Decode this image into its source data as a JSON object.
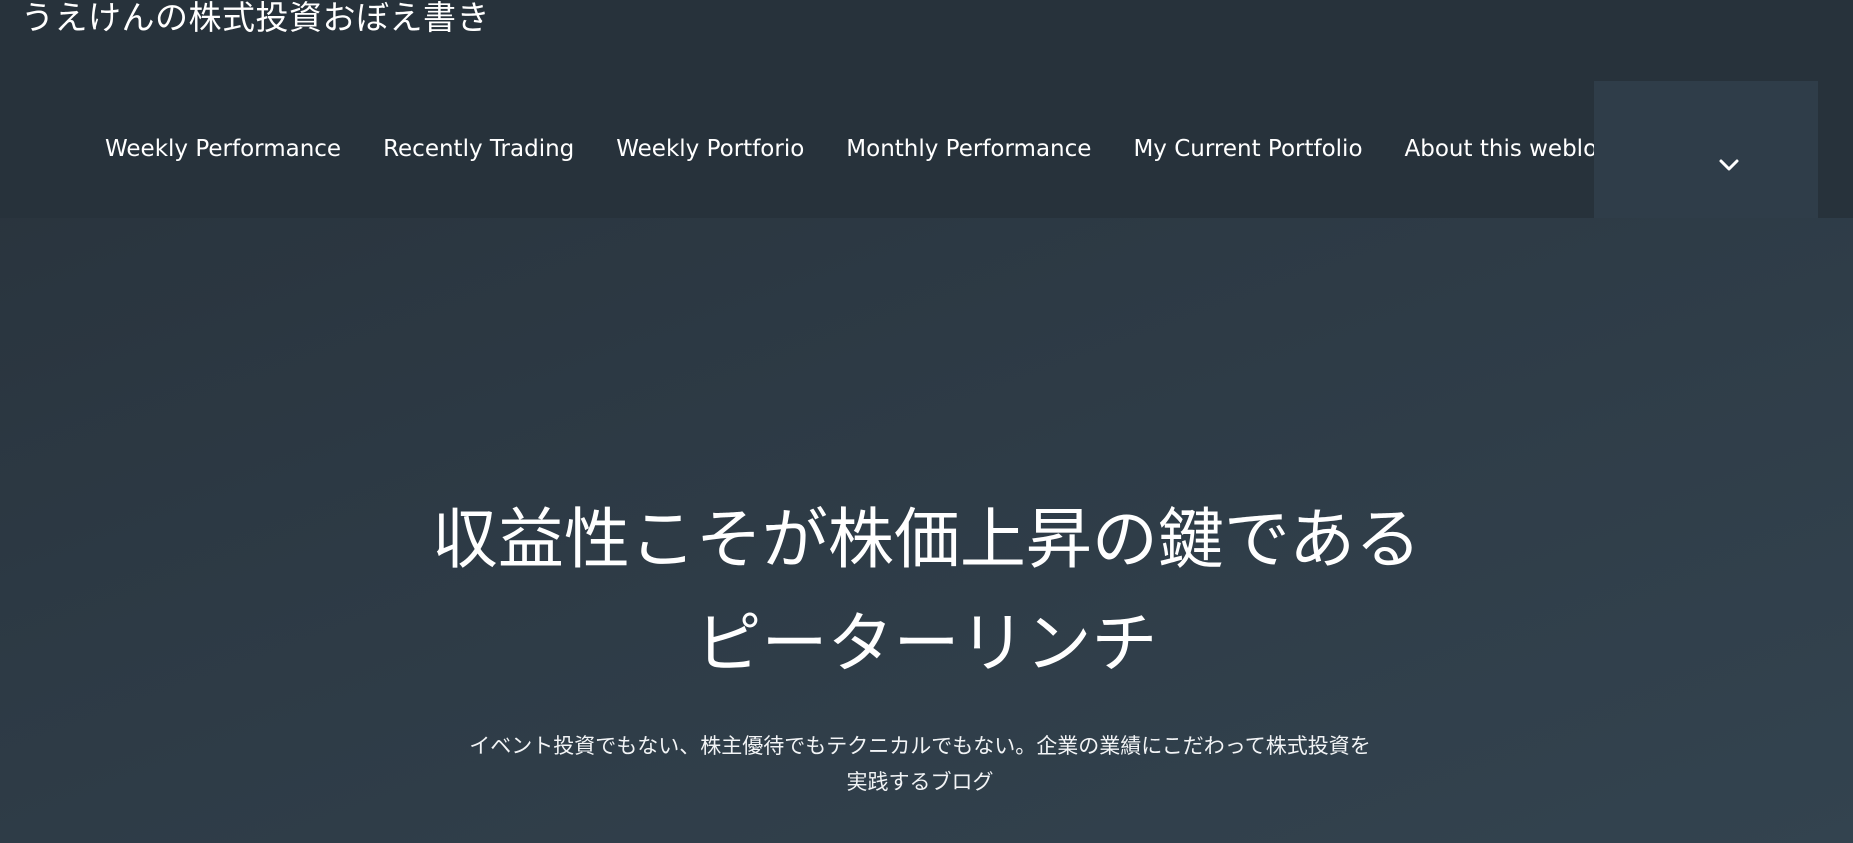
{
  "site": {
    "title": "うえけんの株式投資おぼえ書き"
  },
  "nav": {
    "items": [
      {
        "label": "Weekly Performance"
      },
      {
        "label": "Recently Trading"
      },
      {
        "label": "Weekly Portforio"
      },
      {
        "label": "Monthly Performance"
      },
      {
        "label": "My Current Portfolio"
      },
      {
        "label": "About this weblog"
      }
    ],
    "more_icon": "chevron-down-icon"
  },
  "hero": {
    "quote_line1": "収益性こそが株価上昇の鍵である",
    "quote_line2": "ピーターリンチ",
    "description": "イベント投資でもない、株主優待でもテクニカルでもない。企業の業績にこだわって株式投資を実践するブログ"
  },
  "colors": {
    "header_bg": "#27323b",
    "toggle_bg": "#2f3d49",
    "hero_bg_start": "#28323b",
    "hero_bg_end": "#33434f",
    "text": "#ffffff"
  }
}
